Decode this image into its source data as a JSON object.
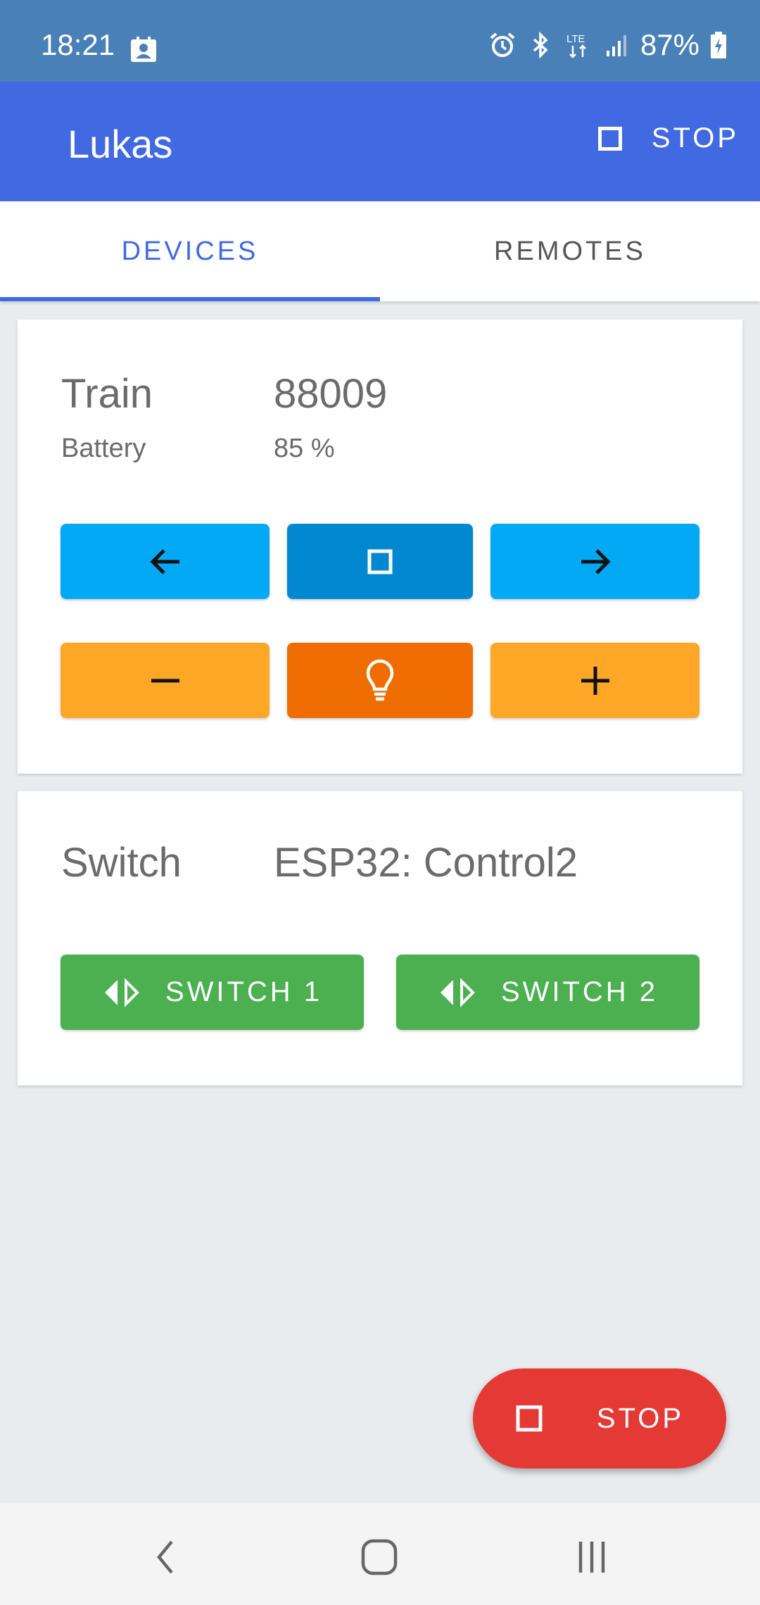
{
  "status_bar": {
    "time": "18:21",
    "battery_pct": "87%",
    "network": "LTE",
    "icons": [
      "contact-card-icon",
      "alarm-icon",
      "bluetooth-icon",
      "lte-icon",
      "signal-icon",
      "battery-charging-icon"
    ]
  },
  "app_bar": {
    "title": "Lukas",
    "stop_label": "STOP"
  },
  "tabs": [
    {
      "label": "DEVICES",
      "active": true
    },
    {
      "label": "REMOTES",
      "active": false
    }
  ],
  "train_card": {
    "type_label": "Train",
    "name": "88009",
    "battery_label": "Battery",
    "battery_value": "85 %",
    "buttons": [
      "arrow-left-icon",
      "stop-square-icon",
      "arrow-right-icon",
      "minus-icon",
      "lightbulb-icon",
      "plus-icon"
    ]
  },
  "switch_card": {
    "type_label": "Switch",
    "name": "ESP32: Control2",
    "switch1_label": "SWITCH 1",
    "switch2_label": "SWITCH 2"
  },
  "fab": {
    "label": "STOP"
  },
  "colors": {
    "app_bar": "#4169e1",
    "status_bar": "#4a80b8",
    "blue_button": "#03a9f4",
    "blue_button_active": "#0288d1",
    "orange_button": "#ffa726",
    "orange_button_active": "#ef6c00",
    "green_button": "#4caf50",
    "fab": "#e53935"
  }
}
